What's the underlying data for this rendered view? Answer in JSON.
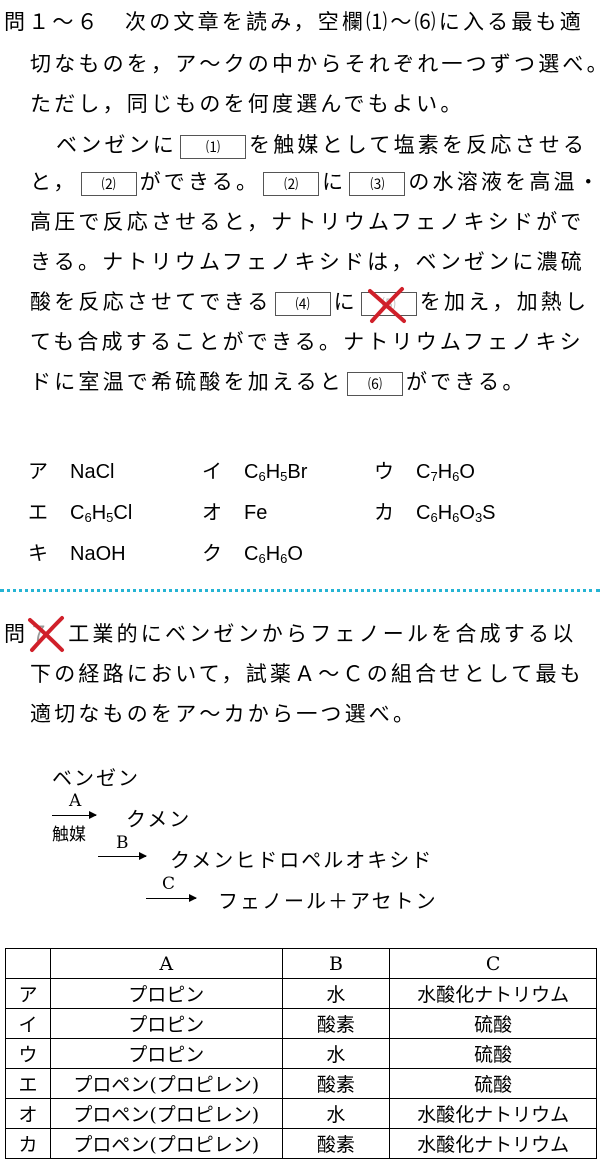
{
  "q1": {
    "l1": "問１～６　次の文章を読み，空欄⑴～⑹に入る最も適",
    "l2": "切なものを，ア～クの中からそれぞれ一つずつ選べ。",
    "l3": "ただし，同じものを何度選んでもよい。",
    "p1a": "ベンゼンに",
    "p1b": "を触媒として塩素を反応させる",
    "p2a": "と，",
    "p2b": "ができる。",
    "p2c": "に",
    "p2d": "の水溶液を高温・",
    "p3": "高圧で反応させると，ナトリウムフェノキシドがで",
    "p4": "きる。ナトリウムフェノキシドは，ベンゼンに濃硫",
    "p5a": "酸を反応させてできる",
    "p5b": "に",
    "p5c": "を加え，加熱し",
    "p6": "ても合成することができる。ナトリウムフェノキシ",
    "p7a": "ドに室温で希硫酸を加えると",
    "p7b": "ができる。",
    "b1": "⑴",
    "b2": "⑵",
    "b3": "⑶",
    "b4": "⑷",
    "b5": "⑸",
    "b6": "⑹"
  },
  "choices": [
    {
      "key": "ア",
      "formula": "NaCl"
    },
    {
      "key": "イ",
      "formula": "C6H5Br"
    },
    {
      "key": "ウ",
      "formula": "C7H6O"
    },
    {
      "key": "エ",
      "formula": "C6H5Cl"
    },
    {
      "key": "オ",
      "formula": "Fe"
    },
    {
      "key": "カ",
      "formula": "C6H6O3S"
    },
    {
      "key": "キ",
      "formula": "NaOH"
    },
    {
      "key": "ク",
      "formula": "C6H6O"
    }
  ],
  "q2": {
    "label": "問",
    "l1": "工業的にベンゼンからフェノールを合成する以",
    "l2": "下の経路において，試薬Ａ～Ｃの組合せとして最も",
    "l3": "適切なものをア～カから一つ選べ。"
  },
  "scheme": {
    "benzene": "ベンゼン",
    "a": "A",
    "catalyst": "触媒",
    "cumene": "クメン",
    "b": "B",
    "hydroperoxide": "クメンヒドロペルオキシド",
    "c": "C",
    "products": "フェノール＋アセトン"
  },
  "table": {
    "headers": [
      "",
      "A",
      "B",
      "C"
    ],
    "rows": [
      [
        "ア",
        "プロピン",
        "水",
        "水酸化ナトリウム"
      ],
      [
        "イ",
        "プロピン",
        "酸素",
        "硫酸"
      ],
      [
        "ウ",
        "プロピン",
        "水",
        "硫酸"
      ],
      [
        "エ",
        "プロペン(プロピレン)",
        "酸素",
        "硫酸"
      ],
      [
        "オ",
        "プロペン(プロピレン)",
        "水",
        "水酸化ナトリウム"
      ],
      [
        "カ",
        "プロペン(プロピレン)",
        "酸素",
        "水酸化ナトリウム"
      ]
    ]
  },
  "colors": {
    "cross": "#d0202a",
    "divider": "#25b4d4"
  }
}
